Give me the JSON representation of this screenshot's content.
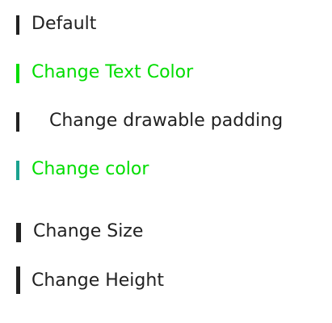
{
  "items": [
    {
      "label": "Default",
      "text_color": "#212121",
      "bar_color": "#212121"
    },
    {
      "label": "Change Text Color",
      "text_color": "#00dd00",
      "bar_color": "#00dd00"
    },
    {
      "label": "Change drawable padding",
      "text_color": "#212121",
      "bar_color": "#212121"
    },
    {
      "label": "Change color",
      "text_color": "#00dd00",
      "bar_color": "#1aa28f"
    },
    {
      "label": "Change Size",
      "text_color": "#212121",
      "bar_color": "#212121"
    },
    {
      "label": "Change Height",
      "text_color": "#212121",
      "bar_color": "#212121"
    }
  ]
}
